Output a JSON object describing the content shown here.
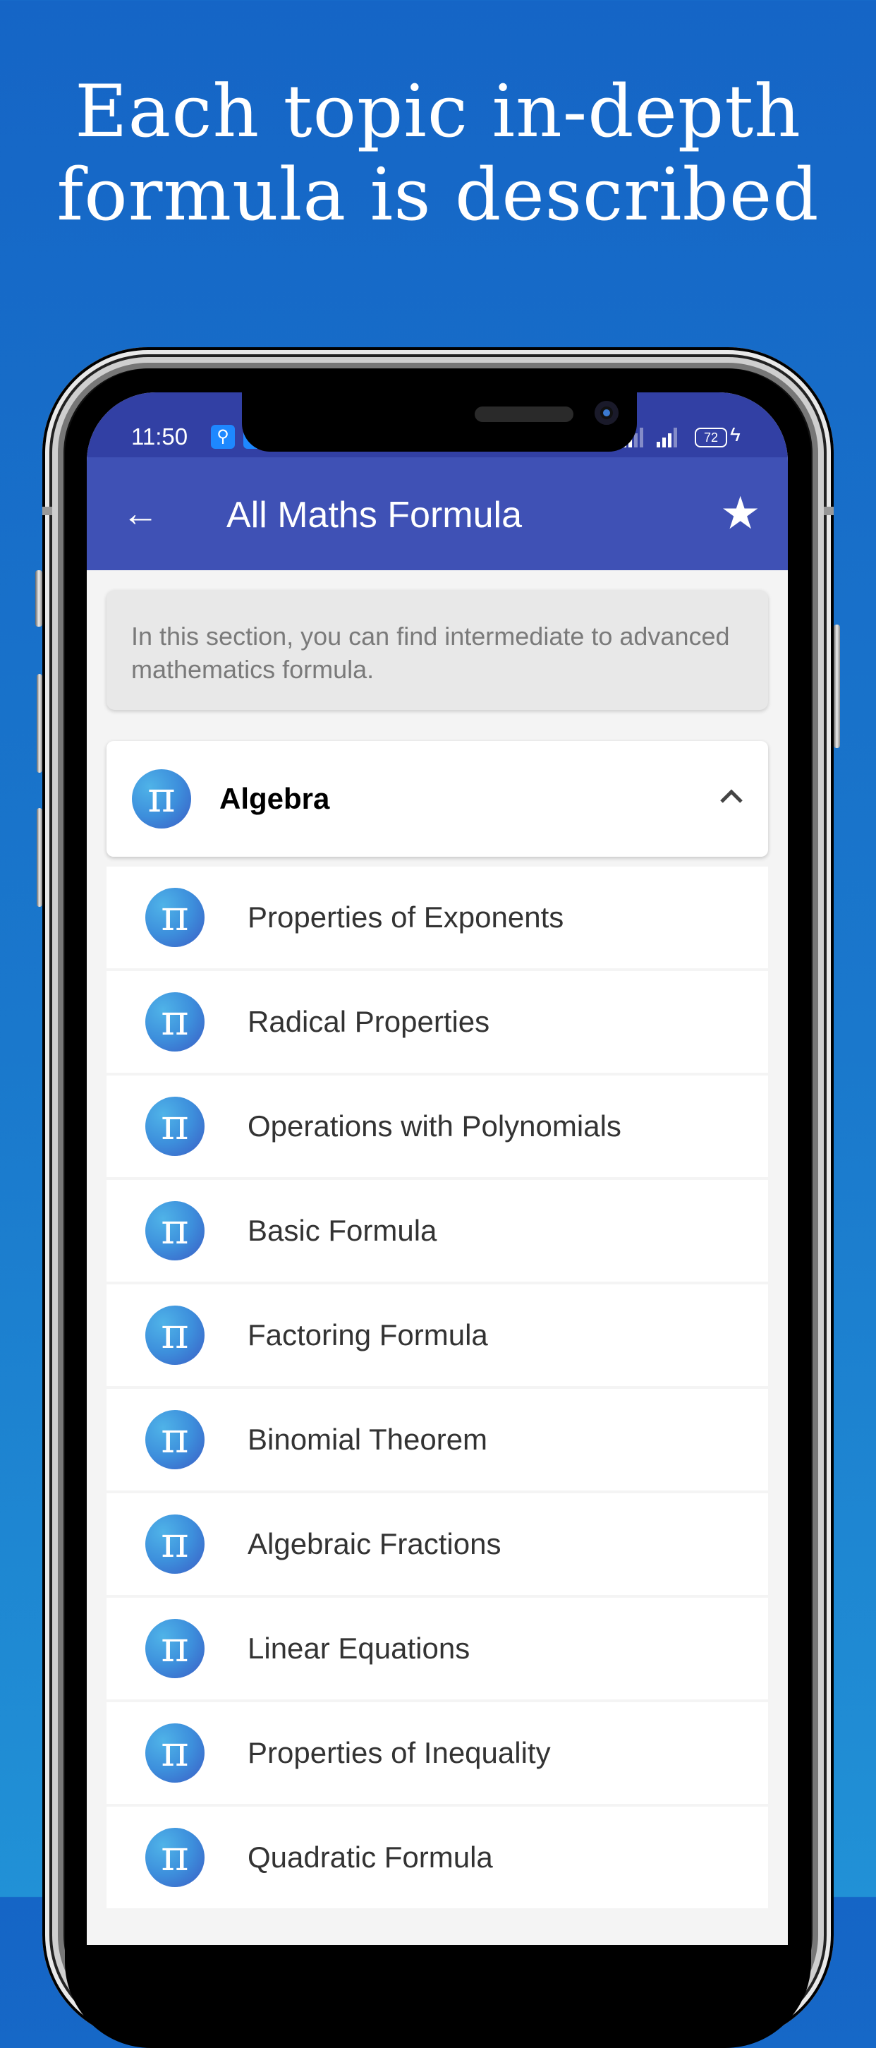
{
  "headline": {
    "line1": "Each topic in-depth",
    "line2": "formula is described"
  },
  "status_bar": {
    "time": "11:50",
    "battery": "72",
    "icons": [
      "usb-icon",
      "notification-icon",
      "signal-icon",
      "signal-icon",
      "battery-icon",
      "charging-bolt-icon"
    ]
  },
  "app_bar": {
    "back_icon": "←",
    "title": "All Maths Formula",
    "favorite_icon": "★"
  },
  "info_card": {
    "text": "In this section, you can find intermediate to advanced mathematics formula."
  },
  "section": {
    "icon": "π",
    "title": "Algebra",
    "expanded": true,
    "items": [
      {
        "icon": "π",
        "label": "Properties of Exponents"
      },
      {
        "icon": "π",
        "label": "Radical Properties"
      },
      {
        "icon": "π",
        "label": "Operations with Polynomials"
      },
      {
        "icon": "π",
        "label": "Basic Formula"
      },
      {
        "icon": "π",
        "label": "Factoring Formula"
      },
      {
        "icon": "π",
        "label": "Binomial Theorem"
      },
      {
        "icon": "π",
        "label": "Algebraic Fractions"
      },
      {
        "icon": "π",
        "label": "Linear Equations"
      },
      {
        "icon": "π",
        "label": "Properties of Inequality"
      },
      {
        "icon": "π",
        "label": "Quadratic Formula"
      }
    ]
  },
  "colors": {
    "background": "#1a78cc",
    "status_bar": "#3240a4",
    "app_bar": "#3f51b5",
    "info_card": "#e8e8e8",
    "info_text": "#7a7a7a",
    "list_text": "#333333"
  }
}
